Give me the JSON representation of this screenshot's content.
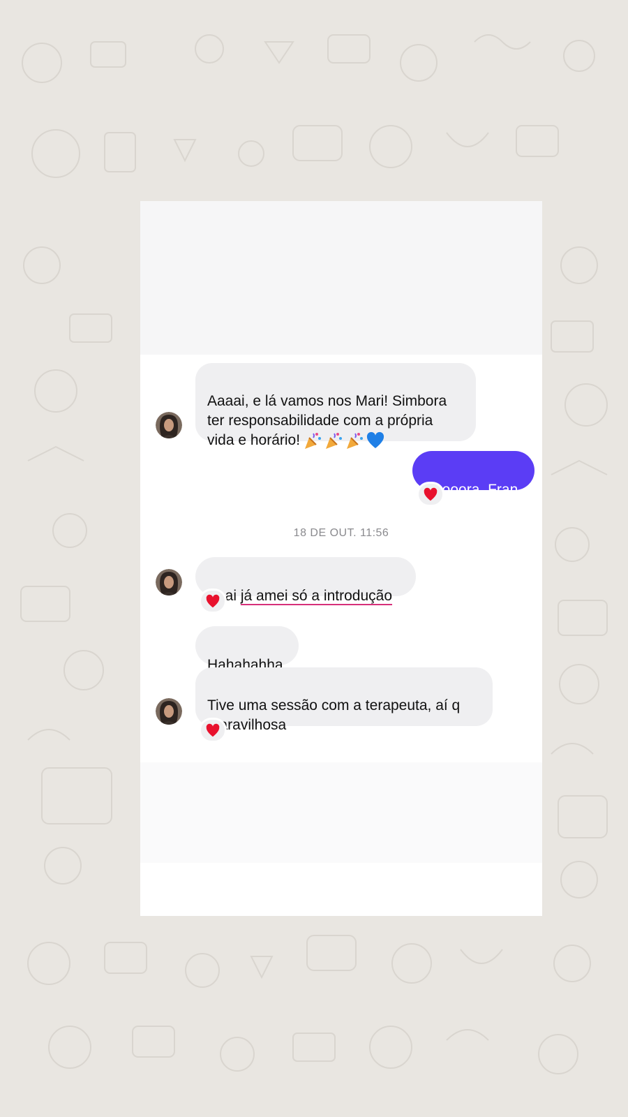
{
  "colors": {
    "background": "#e9e6e1",
    "incoming_bubble": "#efeff1",
    "outgoing_bubble": "#5b3df5",
    "reaction_heart": "#e8112d",
    "spell_underline": "#d6307a"
  },
  "messages": [
    {
      "direction": "incoming",
      "text": "Aaaai, e lá vamos nos Mari! Simbora\nter responsabilidade com a própria\nvida e horário!",
      "emoji": [
        "party-popper-icon",
        "party-popper-icon",
        "party-popper-icon",
        "blue-heart-icon"
      ]
    },
    {
      "direction": "outgoing",
      "text": "Boooora, Fran",
      "reaction": "heart-icon"
    },
    {
      "direction": "incoming",
      "text_prefix": "Aaai ",
      "text_underlined": "já amei só a introdução",
      "reaction": "heart-icon"
    },
    {
      "direction": "incoming",
      "text": "Hahahahha"
    },
    {
      "direction": "incoming",
      "text": "Tive uma sessão com a terapeuta, aí q\nmaravilhosa",
      "reaction": "heart-icon"
    }
  ],
  "timestamp": "18 DE OUT. 11:56"
}
